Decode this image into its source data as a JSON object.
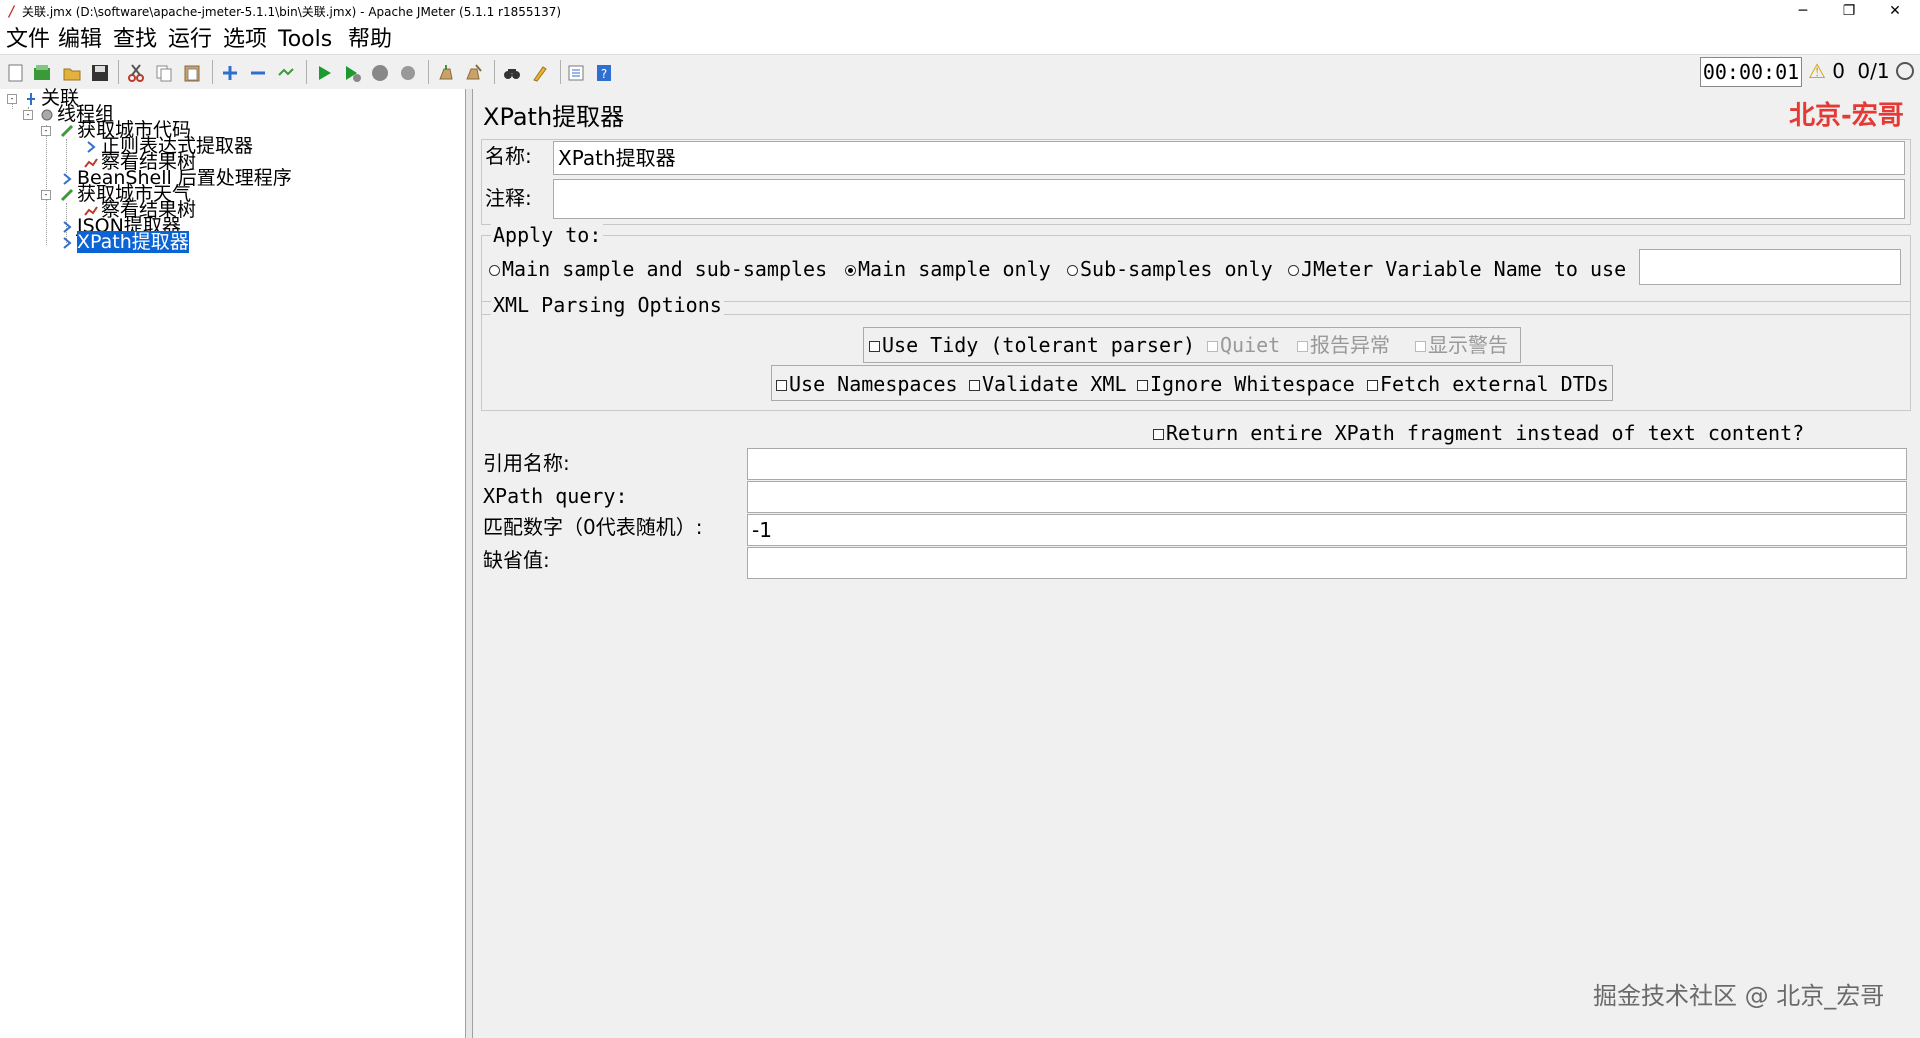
{
  "window": {
    "title": "关联.jmx (D:\\software\\apache-jmeter-5.1.1\\bin\\关联.jmx) - Apache JMeter (5.1.1 r1855137)",
    "minimize": "─",
    "restore": "❐",
    "close": "✕"
  },
  "menu": [
    "文件",
    "编辑",
    "查找",
    "运行",
    "选项",
    "Tools",
    "帮助"
  ],
  "toolbar": {
    "icons": [
      "new-icon",
      "templates-icon",
      "open-icon",
      "save-icon",
      "cut-icon",
      "copy-icon",
      "paste-icon",
      "expand-icon",
      "collapse-icon",
      "toggle-icon",
      "start-icon",
      "start-no-timers-icon",
      "stop-icon",
      "shutdown-icon",
      "clear-icon",
      "clear-all-icon",
      "search-icon",
      "reset-search-icon",
      "function-helper-icon",
      "help-icon"
    ],
    "timer": "00:00:01",
    "warnings": "0",
    "threads": "0/1"
  },
  "tree": {
    "root": "关联",
    "thread_group": "线程组",
    "items": [
      {
        "label": "获取城市代码",
        "level": 2
      },
      {
        "label": "正则表达式提取器",
        "level": 3
      },
      {
        "label": "察看结果树",
        "level": 3
      },
      {
        "label": "BeanShell 后置处理程序",
        "level": 2
      },
      {
        "label": "获取城市天气",
        "level": 2
      },
      {
        "label": "察看结果树",
        "level": 3
      },
      {
        "label": "JSON提取器",
        "level": 3
      },
      {
        "label": "XPath提取器",
        "level": 3,
        "selected": true
      }
    ]
  },
  "panel": {
    "title": "XPath提取器",
    "watermark_top": "北京-宏哥",
    "name_label": "名称:",
    "name_value": "XPath提取器",
    "comment_label": "注释:",
    "comment_value": "",
    "apply_to": {
      "legend": "Apply to:",
      "options": [
        "Main sample and sub-samples",
        "Main sample only",
        "Sub-samples only",
        "JMeter Variable Name to use"
      ],
      "selected": "Main sample only",
      "variable_value": ""
    },
    "xml_options": {
      "legend": "XML Parsing Options",
      "use_tidy": "Use Tidy (tolerant parser)",
      "quiet": "Quiet",
      "report_errors": "报告异常",
      "show_warnings": "显示警告",
      "use_namespaces": "Use Namespaces",
      "validate_xml": "Validate XML",
      "ignore_whitespace": "Ignore Whitespace",
      "fetch_dtds": "Fetch external DTDs"
    },
    "return_fragment": "Return entire XPath fragment instead of text content?",
    "ref_name_label": "引用名称:",
    "ref_name_value": "",
    "xpath_query_label": "XPath query:",
    "xpath_query_value": "",
    "match_no_label": "匹配数字（0代表随机）:",
    "match_no_value": "-1",
    "default_label": "缺省值:",
    "default_value": ""
  },
  "watermark_bottom": "掘金技术社区 @ 北京_宏哥"
}
